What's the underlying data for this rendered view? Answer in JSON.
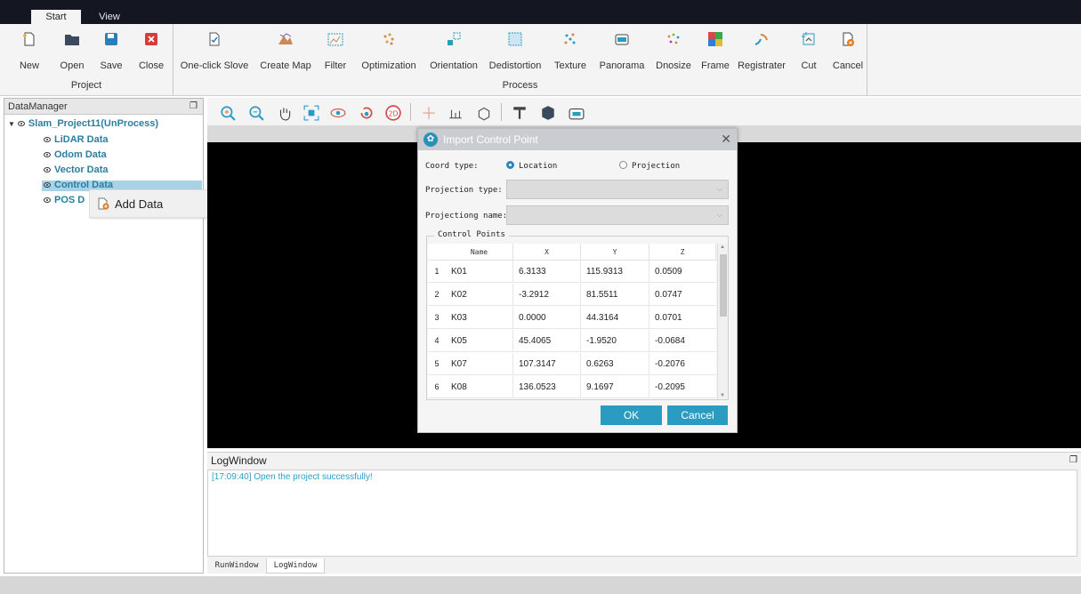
{
  "tabs": [
    {
      "label": "Start",
      "active": true
    },
    {
      "label": "View",
      "active": false
    }
  ],
  "ribbon": {
    "project_group": {
      "label": "Project",
      "buttons": [
        {
          "label": "New",
          "icon": "new-file-icon"
        },
        {
          "label": "Open",
          "icon": "folder-open-icon"
        },
        {
          "label": "Save",
          "icon": "save-icon"
        },
        {
          "label": "Close",
          "icon": "close-icon"
        }
      ]
    },
    "process_group": {
      "label": "Process",
      "buttons": [
        {
          "label": "One-click Slove",
          "icon": "one-click-icon"
        },
        {
          "label": "Create Map",
          "icon": "create-map-icon"
        },
        {
          "label": "Filter",
          "icon": "filter-icon"
        },
        {
          "label": "Optimization",
          "icon": "optimization-icon"
        },
        {
          "label": "Orientation",
          "icon": "orientation-icon"
        },
        {
          "label": "Dedistortion",
          "icon": "dedistortion-icon"
        },
        {
          "label": "Texture",
          "icon": "texture-icon"
        },
        {
          "label": "Panorama",
          "icon": "panorama-icon"
        },
        {
          "label": "Dnosize",
          "icon": "dnosize-icon"
        },
        {
          "label": "Frame",
          "icon": "frame-icon"
        },
        {
          "label": "Registrater",
          "icon": "registrater-icon"
        },
        {
          "label": "Cut",
          "icon": "cut-icon"
        },
        {
          "label": "Cancel",
          "icon": "cancel-icon"
        }
      ]
    }
  },
  "data_manager": {
    "title": "DataManager",
    "project": "Slam_Project11(UnProcess)",
    "items": [
      "LiDAR Data",
      "Odom Data",
      "Vector Data",
      "Control Data",
      "POS D"
    ]
  },
  "context_menu": {
    "add_data": "Add Data"
  },
  "viewer_toolbar": [
    "zoom-in-icon",
    "zoom-out-icon",
    "pan-hand-icon",
    "fit-view-icon",
    "rotate-icon",
    "reset-icon",
    "2d-view-icon",
    "crosshair-icon",
    "measure-icon",
    "box-select-icon",
    "paint-roller-icon",
    "cube-icon",
    "camera-icon"
  ],
  "dialog": {
    "title": "Import Control Point",
    "coord_type_label": "Coord type:",
    "coord_options": [
      {
        "label": "Location",
        "selected": true
      },
      {
        "label": "Projection",
        "selected": false
      }
    ],
    "projection_type_label": "Projection type:",
    "projection_name_label": "Projectiong name:",
    "group_title": "Control Points",
    "columns": [
      "Name",
      "X",
      "Y",
      "Z"
    ],
    "rows": [
      {
        "idx": "1",
        "name": "K01",
        "x": "6.3133",
        "y": "115.9313",
        "z": "0.0509"
      },
      {
        "idx": "2",
        "name": "K02",
        "x": "-3.2912",
        "y": "81.5511",
        "z": "0.0747"
      },
      {
        "idx": "3",
        "name": "K03",
        "x": "0.0000",
        "y": "44.3164",
        "z": "0.0701"
      },
      {
        "idx": "4",
        "name": "K05",
        "x": "45.4065",
        "y": "-1.9520",
        "z": "-0.0684"
      },
      {
        "idx": "5",
        "name": "K07",
        "x": "107.3147",
        "y": "0.6263",
        "z": "-0.2076"
      },
      {
        "idx": "6",
        "name": "K08",
        "x": "136.0523",
        "y": "9.1697",
        "z": "-0.2095"
      }
    ],
    "ok_label": "OK",
    "cancel_label": "Cancel"
  },
  "log_window": {
    "title": "LogWindow",
    "lines": [
      "[17:09:40] Open the project successfully!"
    ],
    "tabs": [
      "RunWindow",
      "LogWindow"
    ]
  },
  "colors": {
    "accent": "#2a9bc1",
    "title_bar": "#141622",
    "tree_text": "#2a7ea0",
    "log_text": "#2f9ec5"
  }
}
